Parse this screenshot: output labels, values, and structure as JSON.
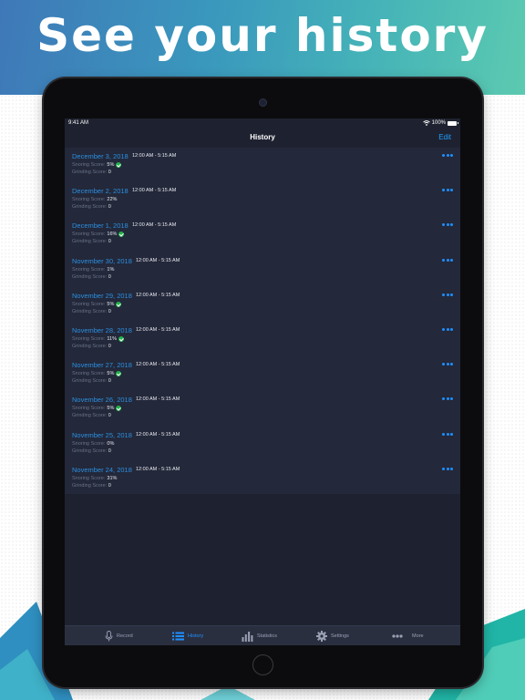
{
  "banner": {
    "headline": "See your history"
  },
  "colors": {
    "accent": "#1e90ff",
    "date": "#2b8fe0",
    "success": "#22b24c",
    "list_bg": "#23283a"
  },
  "status_bar": {
    "time": "9:41 AM",
    "battery": "100%",
    "wifi_icon": "wifi-icon",
    "battery_icon": "battery-icon"
  },
  "nav": {
    "title": "History",
    "edit_label": "Edit"
  },
  "entries": [
    {
      "date": "December 3, 2018",
      "time": "12:00 AM - 5:15 AM",
      "snoring_label": "Snoring Score:",
      "snoring": "5%",
      "check": true,
      "grinding_label": "Grinding Score:",
      "grinding": "0"
    },
    {
      "date": "December 2, 2018",
      "time": "12:00 AM - 5:15 AM",
      "snoring_label": "Snoring Score:",
      "snoring": "22%",
      "check": false,
      "grinding_label": "Grinding Score:",
      "grinding": "0"
    },
    {
      "date": "December 1, 2018",
      "time": "12:00 AM - 5:15 AM",
      "snoring_label": "Snoring Score:",
      "snoring": "16%",
      "check": true,
      "grinding_label": "Grinding Score:",
      "grinding": "0"
    },
    {
      "date": "November 30, 2018",
      "time": "12:00 AM - 5:15 AM",
      "snoring_label": "Snoring Score:",
      "snoring": "1%",
      "check": false,
      "grinding_label": "Grinding Score:",
      "grinding": "0"
    },
    {
      "date": "November 29, 2018",
      "time": "12:00 AM - 5:15 AM",
      "snoring_label": "Snoring Score:",
      "snoring": "5%",
      "check": true,
      "grinding_label": "Grinding Score:",
      "grinding": "0"
    },
    {
      "date": "November 28, 2018",
      "time": "12:00 AM - 5:15 AM",
      "snoring_label": "Snoring Score:",
      "snoring": "11%",
      "check": true,
      "grinding_label": "Grinding Score:",
      "grinding": "0"
    },
    {
      "date": "November 27, 2018",
      "time": "12:00 AM - 5:15 AM",
      "snoring_label": "Snoring Score:",
      "snoring": "5%",
      "check": true,
      "grinding_label": "Grinding Score:",
      "grinding": "0"
    },
    {
      "date": "November 26, 2018",
      "time": "12:00 AM - 5:15 AM",
      "snoring_label": "Snoring Score:",
      "snoring": "5%",
      "check": true,
      "grinding_label": "Grinding Score:",
      "grinding": "0"
    },
    {
      "date": "November 25, 2018",
      "time": "12:00 AM - 5:15 AM",
      "snoring_label": "Snoring Score:",
      "snoring": "0%",
      "check": false,
      "grinding_label": "Grinding Score:",
      "grinding": "0"
    },
    {
      "date": "November 24, 2018",
      "time": "12:00 AM - 5:15 AM",
      "snoring_label": "Snoring Score:",
      "snoring": "31%",
      "check": false,
      "grinding_label": "Grinding Score:",
      "grinding": "0"
    }
  ],
  "tabs": [
    {
      "label": "Record",
      "icon": "microphone-icon",
      "active": false
    },
    {
      "label": "History",
      "icon": "list-icon",
      "active": true
    },
    {
      "label": "Statistics",
      "icon": "bar-chart-icon",
      "active": false
    },
    {
      "label": "Settings",
      "icon": "gear-icon",
      "active": false
    },
    {
      "label": "More",
      "icon": "more-dots-icon",
      "active": false
    }
  ]
}
